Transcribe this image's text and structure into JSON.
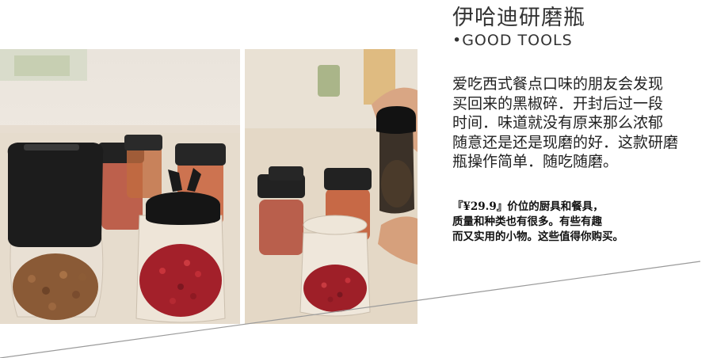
{
  "product": {
    "title": "伊哈迪研磨瓶",
    "subtitle": "•GOOD  TOOLS",
    "description_lines": [
      "爱吃西式餐点口味的朋友会发现",
      "买回来的黑椒碎．开封后过一段",
      "时间．味道就没有原来那么浓郁",
      "随意还是还是现磨的好．这款研磨",
      "瓶操作简单．随吃随磨。"
    ],
    "price_prefix": "『",
    "price": "¥29.9",
    "price_suffix": "』价位的厨具和餐具，",
    "price_lines": [
      "质量和种类也有很多。有些有趣",
      "而又实用的小物。这些值得你购买。"
    ]
  },
  "colors": {
    "text": "#222222",
    "divider": "#9a9a9a"
  }
}
